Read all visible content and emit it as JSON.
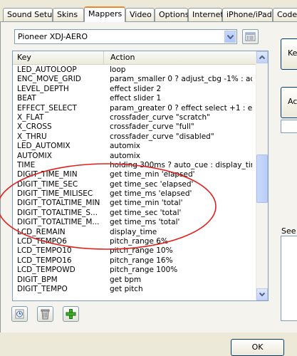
{
  "tabs": [
    "Sound Setup",
    "Skins",
    "Mappers",
    "Video",
    "Options",
    "Internet",
    "iPhone/iPad",
    "Codecs"
  ],
  "active_tab": "Mappers",
  "device_select": {
    "value": "Pioneer XDJ-AERO"
  },
  "list": {
    "columns": [
      "Key",
      "Action"
    ],
    "rows": [
      {
        "key": "LED_AUTOLOOP",
        "action": "loop"
      },
      {
        "key": "ENC_MOVE_GRID",
        "action": "param_smaller 0 ? adjust_cbg -1% : adj..."
      },
      {
        "key": "LEVEL_DEPTH",
        "action": "effect slider 2"
      },
      {
        "key": "BEAT",
        "action": "effect slider 1"
      },
      {
        "key": "EFFECT_SELECT",
        "action": "param_greater 0 ? effect select +1 : eff..."
      },
      {
        "key": "X_FLAT",
        "action": "crossfader_curve \"scratch\""
      },
      {
        "key": "X_CROSS",
        "action": "crossfader_curve \"full\""
      },
      {
        "key": "X_THRU",
        "action": "crossfader_curve \"disabled\""
      },
      {
        "key": "LED_AUTOMIX",
        "action": "automix"
      },
      {
        "key": "AUTOMIX",
        "action": "automix"
      },
      {
        "key": "TIME",
        "action": "holding 300ms ? auto_cue : display_tim..."
      },
      {
        "key": "DIGIT_TIME_MIN",
        "action": "get time_min 'elapsed'"
      },
      {
        "key": "DIGIT_TIME_SEC",
        "action": "get time_sec 'elapsed'"
      },
      {
        "key": "DIGIT_TIME_MILISEC",
        "action": "get time_ms 'elapsed'"
      },
      {
        "key": "DIGIT_TOTALTIME_MIN",
        "action": "get time_min 'total'"
      },
      {
        "key": "DIGIT_TOTALTIME_S...",
        "action": "get time_sec 'total'"
      },
      {
        "key": "DIGIT_TOTALTIME_M...",
        "action": "get time_ms 'total'"
      },
      {
        "key": "LCD_REMAIN",
        "action": "display_time"
      },
      {
        "key": "LCD_TEMPO6",
        "action": "pitch_range 6%"
      },
      {
        "key": "LCD_TEMPO10",
        "action": "pitch_range 10%"
      },
      {
        "key": "LCD_TEMPO16",
        "action": "pitch_range 16%"
      },
      {
        "key": "LCD_TEMPOWD",
        "action": "pitch_range 100%"
      },
      {
        "key": "DIGIT_BPM",
        "action": "get bpm"
      },
      {
        "key": "DIGIT_TEMPO",
        "action": "get pitch"
      }
    ]
  },
  "right_panel": {
    "key_button_label": "Ke",
    "action_button_label": "Act",
    "see_label": "See"
  },
  "ok_label": "OK",
  "annotation_color": "#e0201c",
  "icons": {
    "device_properties": "properties-icon",
    "add_device": "clock-icon",
    "delete": "trash-icon",
    "add": "plus-icon"
  }
}
